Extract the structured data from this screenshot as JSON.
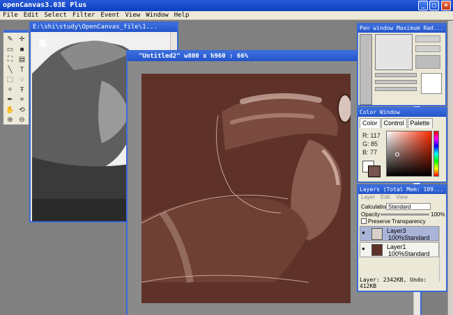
{
  "app": {
    "title": "openCanvas3.03E Plus",
    "controls": {
      "minimize": "_",
      "maximize": "□",
      "close": "×"
    }
  },
  "menu": [
    "File",
    "Edit",
    "Select",
    "Filter",
    "Event",
    "View",
    "Window",
    "Help"
  ],
  "toolbox": {
    "tools": [
      {
        "name": "pen-tool-icon",
        "glyph": "✎"
      },
      {
        "name": "move-tool-icon",
        "glyph": "✛"
      },
      {
        "name": "rectangle-select-icon",
        "glyph": "▭"
      },
      {
        "name": "fill-black-icon",
        "glyph": "■"
      },
      {
        "name": "bucket-fill-icon",
        "glyph": "⛶"
      },
      {
        "name": "gradient-icon",
        "glyph": "▤"
      },
      {
        "name": "line-tool-icon",
        "glyph": "╲"
      },
      {
        "name": "text-tool-icon",
        "glyph": "T"
      },
      {
        "name": "marquee-icon",
        "glyph": "⬚"
      },
      {
        "name": "lasso-icon",
        "glyph": "◌"
      },
      {
        "name": "magic-wand-icon",
        "glyph": "✧"
      },
      {
        "name": "text-vertical-icon",
        "glyph": "Ŧ"
      },
      {
        "name": "eyedropper-icon",
        "glyph": "✒"
      },
      {
        "name": "crop-icon",
        "glyph": "⌗"
      },
      {
        "name": "hand-tool-icon",
        "glyph": "✋"
      },
      {
        "name": "rotate-tool-icon",
        "glyph": "⟲"
      },
      {
        "name": "zoom-in-icon",
        "glyph": "⊕"
      },
      {
        "name": "zoom-out-icon",
        "glyph": "⊖"
      }
    ]
  },
  "reference_window": {
    "title": "E:\\shi\\study\\OpenCanvas_file\\1...",
    "overlay_text": "图"
  },
  "canvas_window": {
    "title": "\"Untitled2\" w800 x h960 : 66%"
  },
  "pen_window": {
    "title": "Pen window  Maximum Rad..."
  },
  "color_window": {
    "title": "Color Window",
    "tabs": [
      "Color",
      "Control",
      "Palette"
    ],
    "active_tab": "Color",
    "r_label": "R:",
    "r": "117",
    "g_label": "G:",
    "g": "85",
    "b_label": "B:",
    "b": "77",
    "fg_color": "#75554d",
    "bg_color": "#ffffff"
  },
  "layer_window": {
    "title": "Layers (Total Mem: 109...",
    "menu": [
      "Layer",
      "Edit",
      "View"
    ],
    "calculation_label": "Calculation",
    "calculation_value": "Standard",
    "opacity_label": "Opacity",
    "opacity_value": "100%",
    "preserve_label": "Preserve Transparency",
    "layers": [
      {
        "name": "Layer3",
        "mode": "100%Standard",
        "selected": true
      },
      {
        "name": "Layer1",
        "mode": "100%Standard",
        "selected": false
      }
    ],
    "status": "Layer: 2342KB, Undo: 412KB"
  }
}
